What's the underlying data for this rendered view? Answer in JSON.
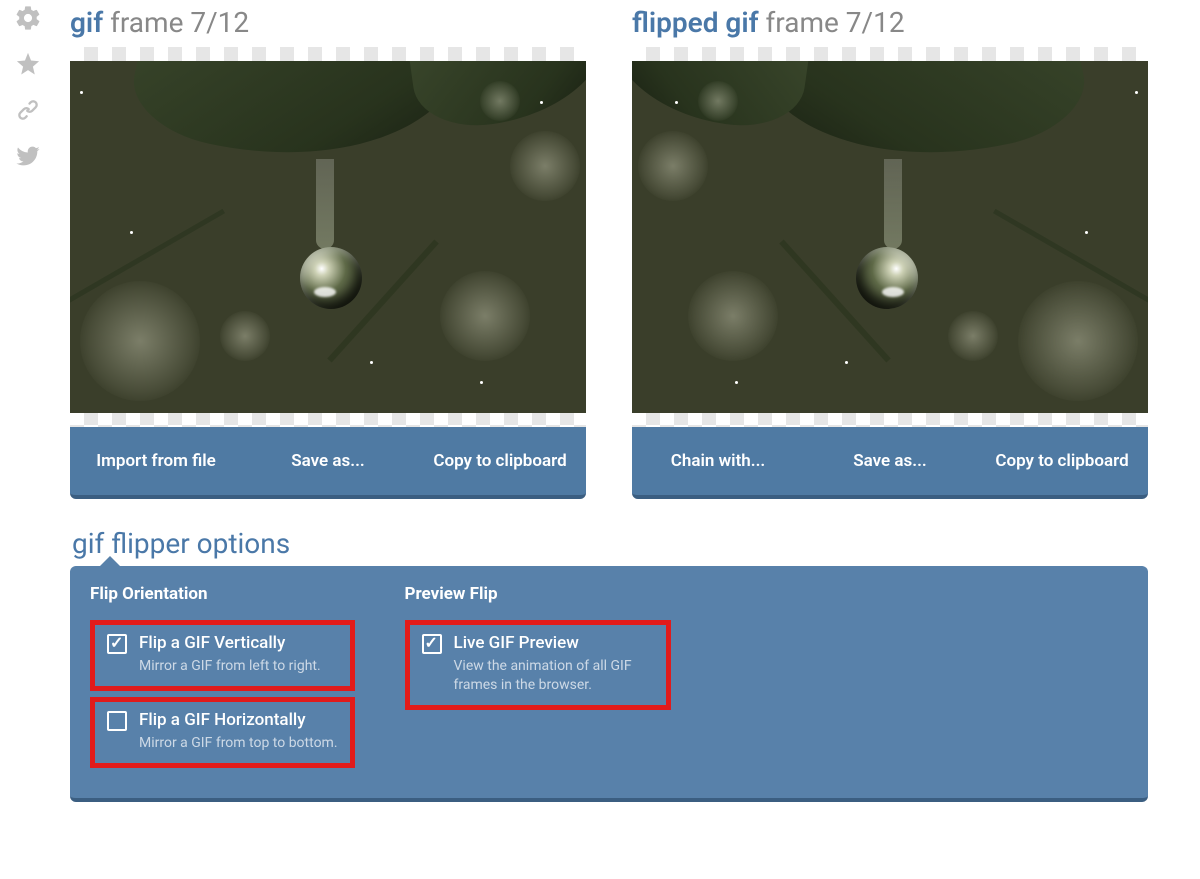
{
  "sidebar_icons": [
    "gear-icon",
    "star-icon",
    "link-icon",
    "twitter-icon"
  ],
  "left_panel": {
    "title_brand": "gif",
    "title_rest": " frame 7/12",
    "buttons": [
      "Import from file",
      "Save as...",
      "Copy to clipboard"
    ]
  },
  "right_panel": {
    "title_brand": "flipped gif",
    "title_rest": " frame 7/12",
    "buttons": [
      "Chain with...",
      "Save as...",
      "Copy to clipboard"
    ]
  },
  "options": {
    "title": "gif flipper options",
    "groups": [
      {
        "heading": "Flip Orientation",
        "items": [
          {
            "label": "Flip a GIF Vertically",
            "desc": "Mirror a GIF from left to right.",
            "checked": true,
            "highlight": true
          },
          {
            "label": "Flip a GIF Horizontally",
            "desc": "Mirror a GIF from top to bottom.",
            "checked": false,
            "highlight": true
          }
        ]
      },
      {
        "heading": "Preview Flip",
        "items": [
          {
            "label": "Live GIF Preview",
            "desc": "View the animation of all GIF frames in the browser.",
            "checked": true,
            "highlight": true
          }
        ]
      }
    ]
  }
}
